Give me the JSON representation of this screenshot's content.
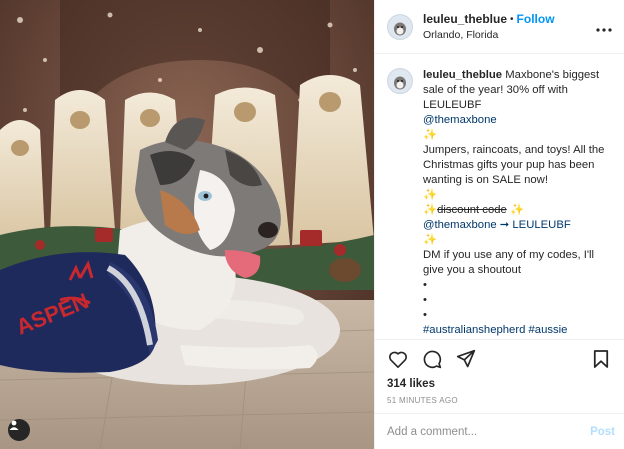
{
  "header": {
    "username": "leuleu_theblue",
    "separator": "•",
    "follow_label": "Follow",
    "location": "Orlando, Florida",
    "more_icon": "more-horizontal-icon"
  },
  "caption": {
    "username": "leuleu_theblue",
    "lines": [
      "Maxbone's biggest sale of the year! 30% off with LEULEUBF",
      "@themaxbone",
      "✨",
      "Jumpers, raincoats, and toys! All the Christmas gifts your pup has been wanting is on SALE now!",
      "✨",
      "✨",
      "discount code",
      "✨",
      "@themaxbone ➞ LEULEUBF",
      "✨",
      "DM if you use any of my codes, I'll give you a shoutout",
      "•",
      "•",
      "•",
      "#australianshepherd #aussie #aussiepuppy #aussiesdoingthings #australianshepherdsofinstagram #aussielove #aussiesofinstagram"
    ]
  },
  "actions": {
    "like_icon": "heart-icon",
    "comment_icon": "comment-icon",
    "share_icon": "share-icon",
    "save_icon": "bookmark-icon"
  },
  "likes": "314 likes",
  "time": "51 MINUTES AGO",
  "comment_box": {
    "placeholder": "Add a comment...",
    "post_label": "Post"
  },
  "photo": {
    "sweater_text": "ASPEN",
    "tag_icon": "user-tag-icon"
  },
  "colors": {
    "link": "#00376b",
    "follow": "#0095f6",
    "post_disabled": "#b2dffc",
    "sweater": "#1f2a5c",
    "sweater_accent": "#c8282e"
  }
}
